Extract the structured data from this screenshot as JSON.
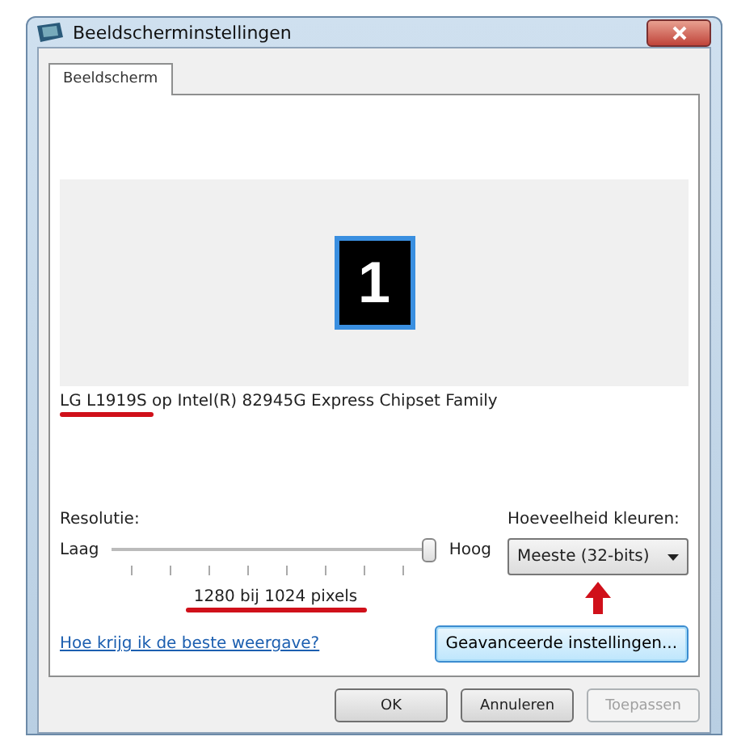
{
  "window": {
    "title": "Beeldscherminstellingen"
  },
  "tabs": [
    {
      "label": "Beeldscherm",
      "selected": true
    }
  ],
  "monitors": [
    {
      "number": "1",
      "selected": true
    }
  ],
  "display_name": "LG L1919S op Intel(R) 82945G Express Chipset Family",
  "resolution": {
    "label": "Resolutie:",
    "low": "Laag",
    "high": "Hoog",
    "level": 1,
    "reading": "1280 bij 1024 pixels"
  },
  "colors": {
    "label": "Hoeveelheid kleuren:",
    "value": "Meeste (32-bits)"
  },
  "help_link": "Hoe krijg ik de beste weergave?",
  "advanced_button": "Geavanceerde instellingen...",
  "buttons": [
    {
      "label": "OK",
      "disabled": false
    },
    {
      "label": "Annuleren",
      "disabled": false
    },
    {
      "label": "Toepassen",
      "disabled": true
    }
  ]
}
